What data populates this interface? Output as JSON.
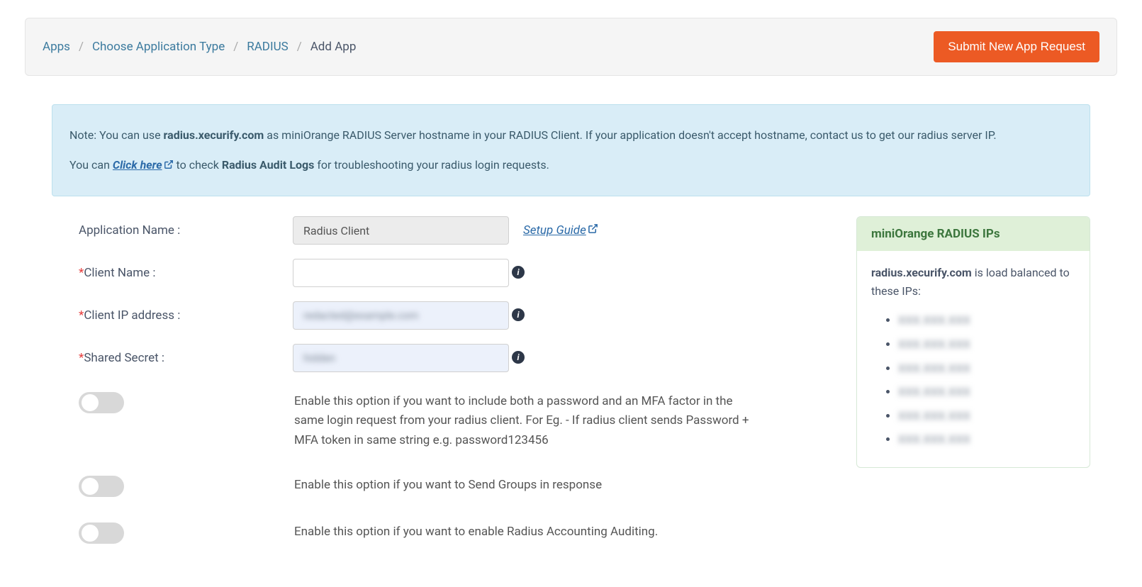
{
  "breadcrumb": {
    "apps": "Apps",
    "choose_type": "Choose Application Type",
    "radius": "RADIUS",
    "add_app": "Add App"
  },
  "header": {
    "submit_button": "Submit New App Request"
  },
  "info_box": {
    "line1_pre": "Note: You can use ",
    "line1_host": "radius.xecurify.com",
    "line1_post": " as miniOrange RADIUS Server hostname in your RADIUS Client. If your application doesn't accept hostname, contact us to get our radius server IP.",
    "line2_pre": "You can ",
    "line2_link": "Click here",
    "line2_mid": " to check ",
    "line2_bold": "Radius Audit Logs",
    "line2_post": " for troubleshooting your radius login requests."
  },
  "form": {
    "app_name_label": "Application Name :",
    "app_name_value": "Radius Client",
    "setup_guide": "Setup Guide",
    "client_name_label": "Client Name :",
    "client_name_value": "",
    "client_ip_label": "Client IP address :",
    "client_ip_value": "redacted@example.com",
    "shared_secret_label": "Shared Secret :",
    "shared_secret_value": "hidden",
    "toggle1_desc": "Enable this option if you want to include both a password and an MFA factor in the same login request from your radius client. For Eg. - If radius client sends Password + MFA token in same string e.g. password123456",
    "toggle2_desc": "Enable this option if you want to Send Groups in response",
    "toggle3_desc": "Enable this option if you want to enable Radius Accounting Auditing."
  },
  "ip_panel": {
    "title": "miniOrange RADIUS IPs",
    "body_host": "radius.xecurify.com",
    "body_post": " is load balanced to these IPs:",
    "ips": [
      "XXX.XXX.XXX",
      "XXX.XXX.XXX",
      "XXX.XXX.XXX",
      "XXX.XXX.XXX",
      "XXX.XXX.XXX",
      "XXX.XXX.XXX"
    ]
  }
}
